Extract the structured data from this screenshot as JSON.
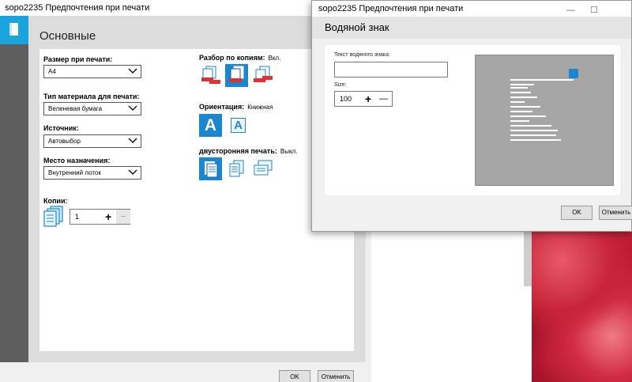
{
  "main_window": {
    "title": "sopo2235 Предпочтения при печати",
    "header": "Основные",
    "paper_size": {
      "label": "Размер при печати:",
      "value": "A4"
    },
    "media_type": {
      "label": "Тип материала для печати:",
      "value": "Веленевая бумага"
    },
    "source": {
      "label": "Источник:",
      "value": "Автовыбор"
    },
    "destination": {
      "label": "Место назначения:",
      "value": "Внутренний лоток"
    },
    "copies": {
      "label": "Копии:",
      "value": "1",
      "plus": "+",
      "minus": "−"
    },
    "collate": {
      "label": "Разбор по копиям:",
      "value": "Вкл."
    },
    "orientation": {
      "label": "Ориентация:",
      "value": "Книжная",
      "icon_glyph": "A"
    },
    "duplex": {
      "label": "двусторонняя печать:",
      "value": "Выкл."
    },
    "ok_label": "OK",
    "cancel_label": "Отменить"
  },
  "watermark_dialog": {
    "title": "sopo2235 Предпочтения при печати",
    "header": "Водяной знак",
    "text_label": "Текст водяного знака:",
    "text_value": "",
    "size_label": "Size:",
    "size_value": "100",
    "plus": "+",
    "minus": "—",
    "ok_label": "OK",
    "cancel_label": "Отменить",
    "minimize_glyph": "—",
    "maximize_glyph": "☐"
  },
  "colors": {
    "accent": "#1a86d0",
    "rail": "#5e5e5e",
    "rail_button": "#1aa3dc",
    "panel_bg": "#dcdcdc",
    "preview_bg": "#a6a6a6"
  }
}
